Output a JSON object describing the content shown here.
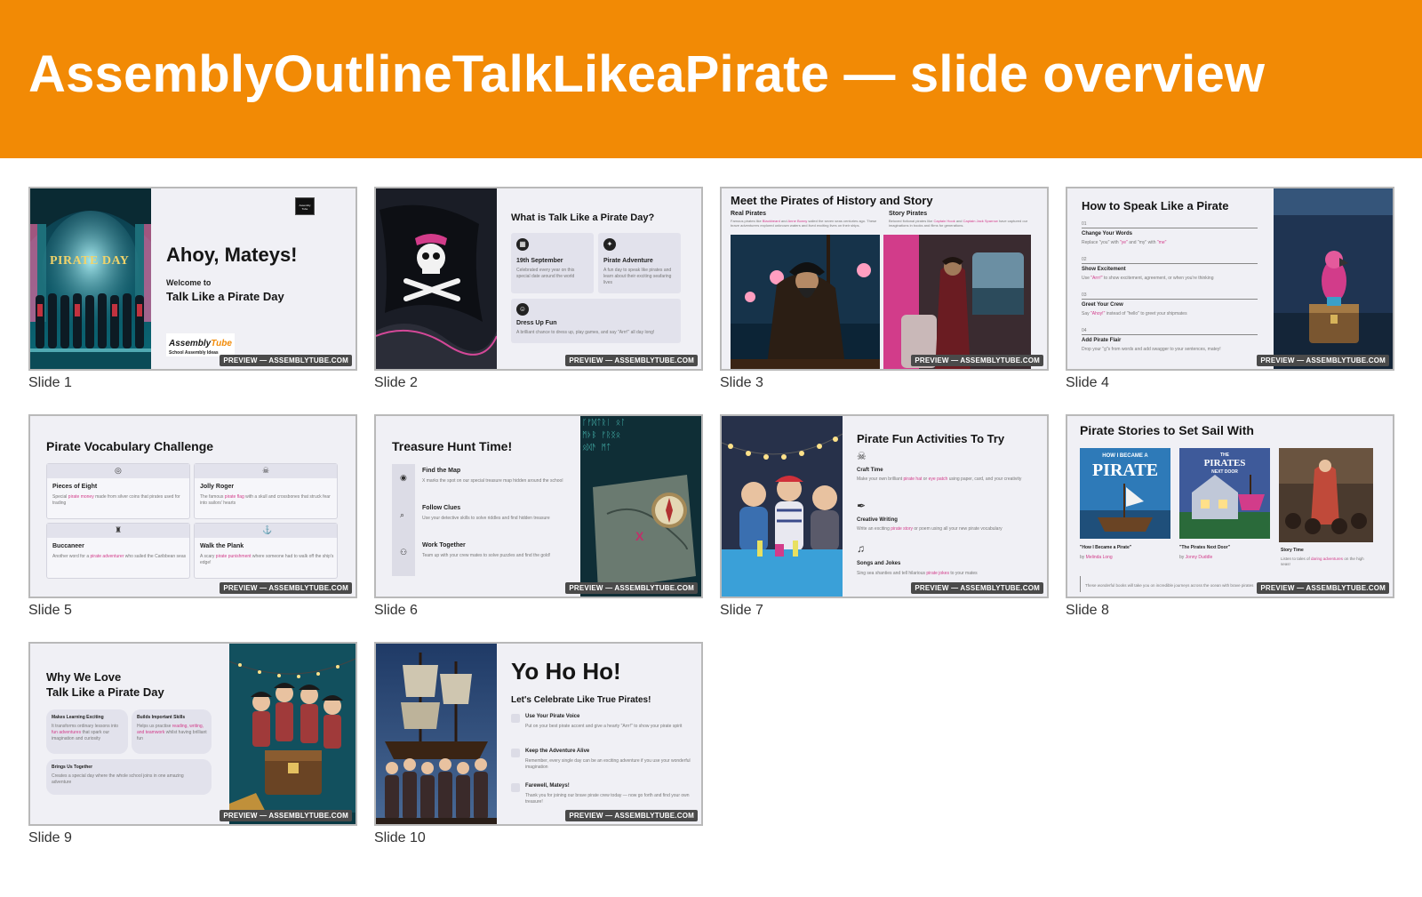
{
  "header": {
    "title": "AssemblyOutlineTalkLikeaPirate — slide overview"
  },
  "watermark": "PREVIEW — ASSEMBLYTUBE.COM",
  "colors": {
    "banner": "#f28a05",
    "accent_pink": "#d23c8a"
  },
  "slides": [
    {
      "caption": "Slide 1",
      "photo_sign": "PIRATE DAY",
      "logo_box": "Assembly Tube",
      "title": "Ahoy, Mateys!",
      "welcome": "Welcome to",
      "subtitle": "Talk Like a Pirate Day",
      "brand_a": "Assembly",
      "brand_b": "Tube",
      "brand_tagline": "School Assembly Ideas"
    },
    {
      "caption": "Slide 2",
      "title": "What is Talk Like a Pirate Day?",
      "cards": [
        {
          "title": "19th September",
          "text": "Celebrated every year on this special date around the world"
        },
        {
          "title": "Pirate Adventure",
          "text": "A fun day to speak like pirates and learn about their exciting seafaring lives"
        },
        {
          "title": "Dress Up Fun",
          "text": "A brilliant chance to dress up, play games, and say \"Arrr!\" all day long!"
        }
      ]
    },
    {
      "caption": "Slide 3",
      "title": "Meet the Pirates of History and Story",
      "cols": [
        {
          "title": "Real Pirates",
          "text_a": "Famous pirates like ",
          "hl_1": "Blackbeard",
          "text_b": " and ",
          "hl_2": "Anne Bonny",
          "text_c": " sailed the seven seas centuries ago. These brave adventurers explored unknown waters and lived exciting lives on their ships."
        },
        {
          "title": "Story Pirates",
          "text_a": "Beloved fictional pirates like ",
          "hl_1": "Captain Hook",
          "text_b": " and ",
          "hl_2": "Captain Jack Sparrow",
          "text_c": " have captured our imaginations in books and films for generations."
        }
      ]
    },
    {
      "caption": "Slide 4",
      "title": "How to Speak Like a Pirate",
      "steps": [
        {
          "num": "01",
          "title": "Change Your Words",
          "text_a": "Replace \"you\" with ",
          "hl": "\"ye\"",
          "text_b": " and \"my\" with ",
          "hl_2": "\"me\""
        },
        {
          "num": "02",
          "title": "Show Excitement",
          "text_a": "Use ",
          "hl": "\"Arrr!\"",
          "text_b": " to show excitement, agreement, or when you're thinking",
          "hl_2": ""
        },
        {
          "num": "03",
          "title": "Greet Your Crew",
          "text_a": "Say ",
          "hl": "\"Ahoy!\"",
          "text_b": " instead of \"hello\" to greet your shipmates",
          "hl_2": ""
        },
        {
          "num": "04",
          "title": "Add Pirate Flair",
          "text_a": "Drop your \"g\"s from words and add swagger to your sentences, matey!",
          "hl": "",
          "text_b": "",
          "hl_2": ""
        }
      ]
    },
    {
      "caption": "Slide 5",
      "title": "Pirate Vocabulary Challenge",
      "cards": [
        {
          "title": "Pieces of Eight",
          "text_a": "Special ",
          "hl": "pirate money",
          "text_b": " made from silver coins that pirates used for trading"
        },
        {
          "title": "Jolly Roger",
          "text_a": "The famous ",
          "hl": "pirate flag",
          "text_b": " with a skull and crossbones that struck fear into sailors' hearts"
        },
        {
          "title": "Buccaneer",
          "text_a": "Another word for a ",
          "hl": "pirate adventurer",
          "text_b": " who sailed the Caribbean seas"
        },
        {
          "title": "Walk the Plank",
          "text_a": "A scary ",
          "hl": "pirate punishment",
          "text_b": " where someone had to walk off the ship's edge!"
        }
      ]
    },
    {
      "caption": "Slide 6",
      "title": "Treasure Hunt Time!",
      "steps": [
        {
          "title": "Find the Map",
          "text": "X marks the spot on our special treasure map hidden around the school"
        },
        {
          "title": "Follow Clues",
          "text": "Use your detective skills to solve riddles and find hidden treasure"
        },
        {
          "title": "Work Together",
          "text": "Team up with your crew mates to solve puzzles and find the gold!"
        }
      ]
    },
    {
      "caption": "Slide 7",
      "title": "Pirate Fun Activities To Try",
      "items": [
        {
          "title": "Craft Time",
          "text_a": "Make your own brilliant ",
          "hl": "pirate hat",
          "text_b": " or ",
          "hl_2": "eye patch",
          "text_c": " using paper, card, and your creativity"
        },
        {
          "title": "Creative Writing",
          "text_a": "Write an exciting ",
          "hl": "pirate story",
          "text_b": " or poem using all your new pirate vocabulary",
          "hl_2": "",
          "text_c": ""
        },
        {
          "title": "Songs and Jokes",
          "text_a": "Sing sea shanties and tell hilarious ",
          "hl": "pirate jokes",
          "text_b": " to your mates",
          "hl_2": "",
          "text_c": ""
        }
      ]
    },
    {
      "caption": "Slide 8",
      "title": "Pirate Stories to Set Sail With",
      "books": [
        {
          "cover_top": "HOW I BECAME A",
          "cover_main": "PIRATE",
          "title": "\"How I Became a Pirate\"",
          "by": "by ",
          "author": "Melinda Long"
        },
        {
          "cover_top": "THE",
          "cover_main": "PIRATES",
          "cover_sub": "NEXT DOOR",
          "title": "\"The Pirates Next Door\"",
          "by": "by ",
          "author": "Jonny Duddle"
        },
        {
          "title": "Story Time",
          "text_a": "Listen to tales of ",
          "hl": "daring adventures",
          "text_b": " on the high seas!"
        }
      ],
      "footer": "These wonderful books will take you on incredible journeys across the ocean with brave pirates"
    },
    {
      "caption": "Slide 9",
      "title_1": "Why We Love",
      "title_2": "Talk Like a Pirate Day",
      "cards": [
        {
          "title": "Makes Learning Exciting",
          "text_a": "It transforms ordinary lessons into ",
          "hl": "fun adventures",
          "text_b": " that spark our imagination and curiosity"
        },
        {
          "title": "Builds Important Skills",
          "text_a": "Helps us practise ",
          "hl": "reading, writing, and teamwork",
          "text_b": " whilst having brilliant fun"
        },
        {
          "title": "Brings Us Together",
          "text_a": "Creates a special day where the whole school joins in one amazing adventure",
          "hl": "",
          "text_b": ""
        }
      ]
    },
    {
      "caption": "Slide 10",
      "title": "Yo Ho Ho!",
      "subtitle": "Let's Celebrate Like True Pirates!",
      "items": [
        {
          "title": "Use Your Pirate Voice",
          "text": "Put on your best pirate accent and give a hearty \"Arrr!\" to show your pirate spirit"
        },
        {
          "title": "Keep the Adventure Alive",
          "text": "Remember, every single day can be an exciting adventure if you use your wonderful imagination"
        },
        {
          "title": "Farewell, Mateys!",
          "text": "Thank you for joining our brave pirate crew today — now go forth and find your own treasure!"
        }
      ]
    }
  ]
}
